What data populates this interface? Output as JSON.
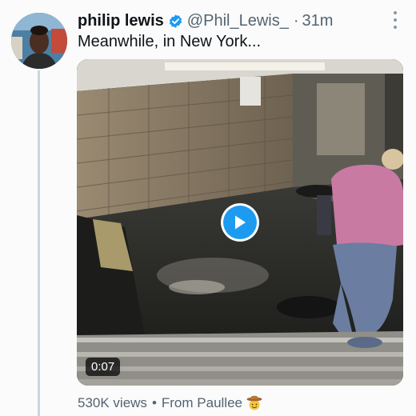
{
  "tweet": {
    "author": {
      "display_name": "philip lewis",
      "handle": "@Phil_Lewis_",
      "verified": true,
      "avatar_icon": "user-avatar"
    },
    "separator": "·",
    "time": "31m",
    "text": "Meanwhile, in New York...",
    "media": {
      "type": "video",
      "duration": "0:07",
      "play_icon": "play-icon"
    },
    "footer": {
      "views": "530K views",
      "separator": "•",
      "source": "From Paullee",
      "source_emoji": "cowboy-emoji"
    }
  },
  "colors": {
    "accent": "#1d9bf0",
    "text_primary": "#0f1419",
    "text_secondary": "#536471",
    "thread_line": "#c9d6df"
  }
}
